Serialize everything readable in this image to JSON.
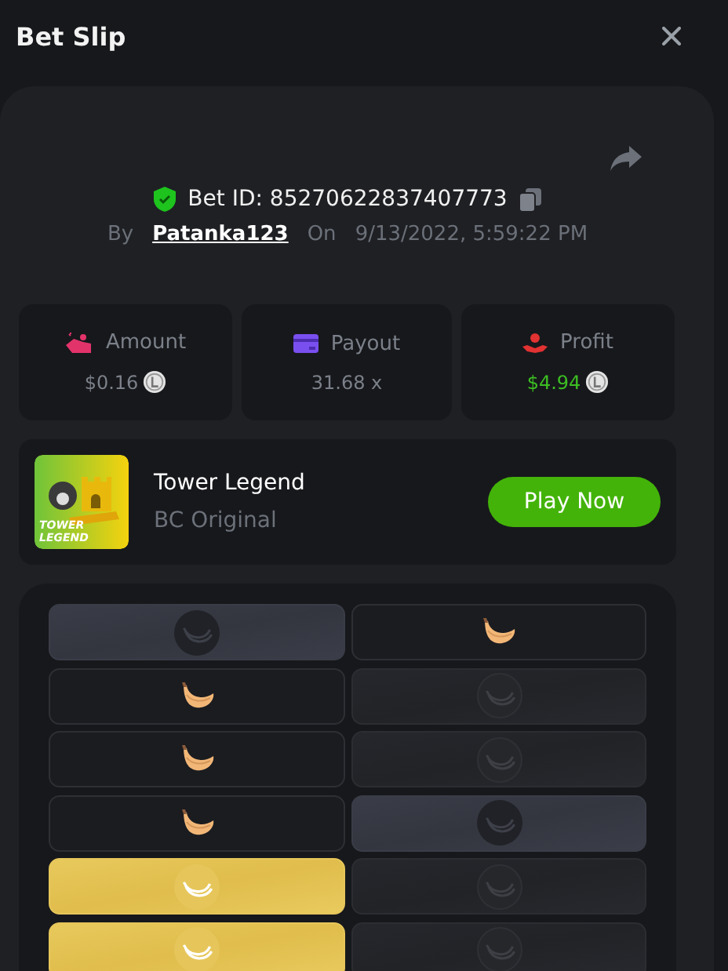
{
  "window": {
    "title": "Bet Slip"
  },
  "bet": {
    "verified": true,
    "id_label": "Bet ID: 85270622837407773",
    "by_label": "By",
    "user": "Patanka123",
    "on_label": "On",
    "date": "9/13/2022, 5:59:22 PM"
  },
  "stats": [
    {
      "kind": "amount",
      "label": "Amount",
      "value": "$0.16",
      "coin": true,
      "positive": false
    },
    {
      "kind": "payout",
      "label": "Payout",
      "value": "31.68 x",
      "coin": false,
      "positive": false
    },
    {
      "kind": "profit",
      "label": "Profit",
      "value": "$4.94",
      "coin": true,
      "positive": true
    }
  ],
  "game": {
    "title": "Tower Legend",
    "subtitle": "BC Original",
    "thumbnail_text": "TOWER LEGEND",
    "button": "Play Now"
  },
  "tiles": [
    {
      "kind": "picked"
    },
    {
      "kind": "banana"
    },
    {
      "kind": "banana"
    },
    {
      "kind": "hidden"
    },
    {
      "kind": "banana"
    },
    {
      "kind": "hidden"
    },
    {
      "kind": "banana"
    },
    {
      "kind": "picked"
    },
    {
      "kind": "gold"
    },
    {
      "kind": "hidden"
    },
    {
      "kind": "gold"
    },
    {
      "kind": "hidden"
    }
  ]
}
